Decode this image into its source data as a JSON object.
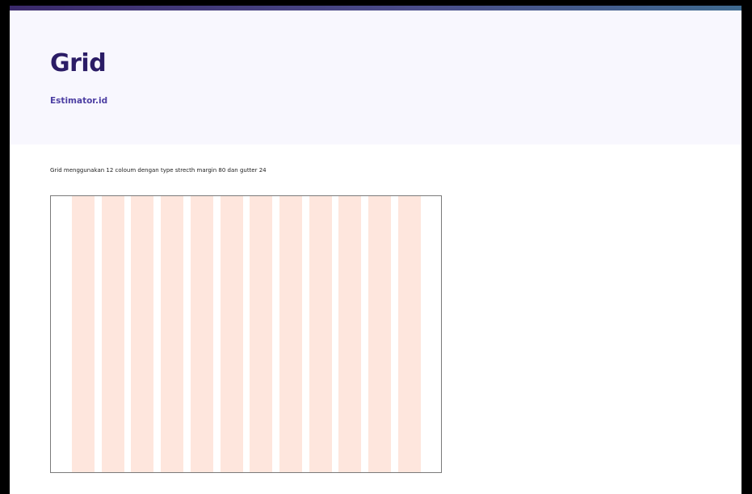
{
  "header": {
    "title": "Grid",
    "subtitle": "Estimator.id"
  },
  "content": {
    "description": "Grid menggunakan 12 coloum dengan type strecth margin 80 dan gutter 24"
  },
  "grid_preview": {
    "columns": 12,
    "type": "strecth",
    "margin": 80,
    "gutter": 24,
    "column_color": "#fee6dd"
  },
  "colors": {
    "title": "#2b1c66",
    "subtitle": "#4d3fa3",
    "header_background": "#f8f7fe"
  }
}
